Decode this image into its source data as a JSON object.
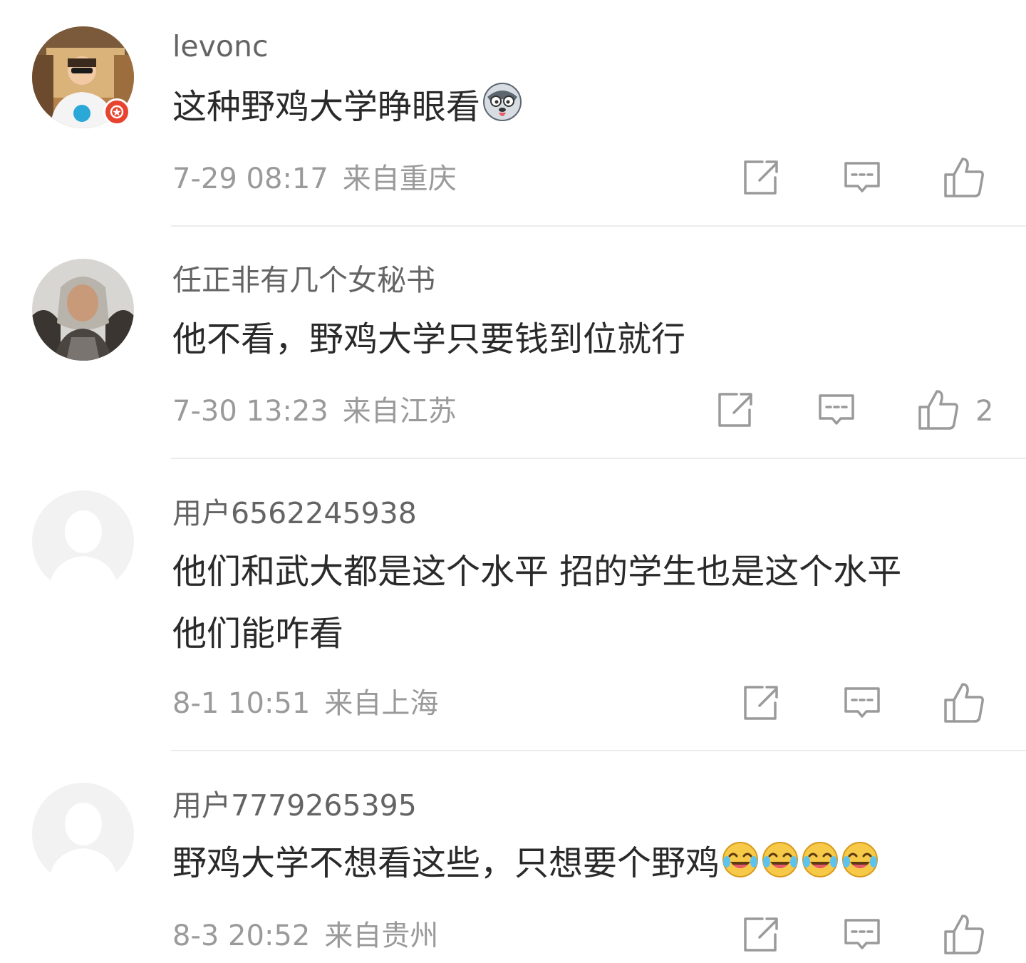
{
  "comments": [
    {
      "username": "levonc",
      "text": "这种野鸡大学睁眼看",
      "date": "7-29 08:17",
      "location": "来自重庆",
      "likes": "",
      "avatar": "photo-man-sunglasses",
      "verified": true,
      "emojis": [
        "husky-emoji"
      ]
    },
    {
      "username": "任正非有几个女秘书",
      "text": "他不看，野鸡大学只要钱到位就行",
      "date": "7-30 13:23",
      "location": "来自江苏",
      "likes": "2",
      "avatar": "photo-old-man-fur",
      "verified": false,
      "emojis": []
    },
    {
      "username": "用户6562245938",
      "text": "他们和武大都是这个水平 招的学生也是这个水平\n他们能咋看",
      "date": "8-1 10:51",
      "location": "来自上海",
      "likes": "",
      "avatar": "default-avatar",
      "verified": false,
      "emojis": []
    },
    {
      "username": "用户7779265395",
      "text": "野鸡大学不想看这些，只想要个野鸡",
      "date": "8-3 20:52",
      "location": "来自贵州",
      "likes": "",
      "avatar": "default-avatar",
      "verified": false,
      "emojis": [
        "laugh-cry-emoji",
        "laugh-cry-emoji",
        "laugh-cry-emoji",
        "laugh-cry-emoji"
      ]
    }
  ],
  "icons": {
    "repost": "share-icon",
    "comment": "comment-icon",
    "like": "thumbs-up-icon"
  },
  "colors": {
    "text": "#2a2a2a",
    "username": "#646464",
    "meta": "#9a9a9a",
    "divider": "#ececec",
    "badge": "#e8432e"
  }
}
